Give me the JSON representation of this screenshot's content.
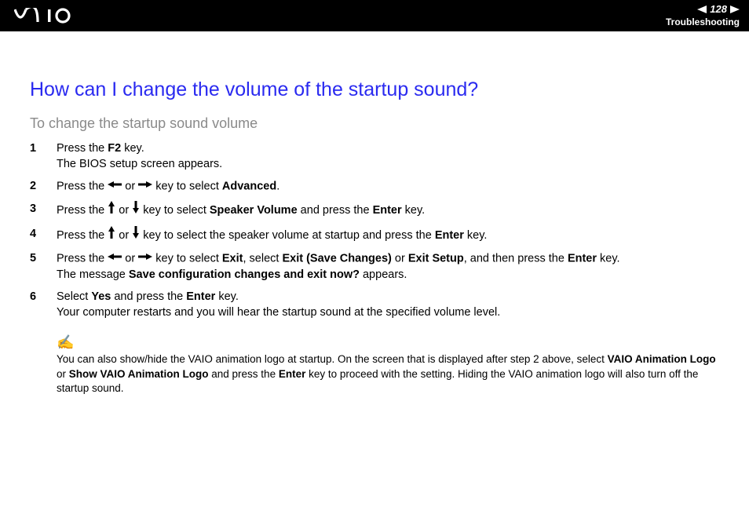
{
  "header": {
    "page_number": "128",
    "section": "Troubleshooting"
  },
  "title": "How can I change the volume of the startup sound?",
  "subtitle": "To change the startup sound volume",
  "steps": [
    {
      "pre1": "Press the ",
      "b1": "F2",
      "post1": " key.",
      "line2": "The BIOS setup screen appears."
    },
    {
      "pre1": "Press the ",
      "mid1": " or ",
      "post1": " key to select ",
      "b1": "Advanced",
      "end1": "."
    },
    {
      "pre1": "Press the ",
      "mid1": " or ",
      "post1": " key to select ",
      "b1": "Speaker Volume",
      "mid2": " and press the ",
      "b2": "Enter",
      "end1": " key."
    },
    {
      "pre1": "Press the ",
      "mid1": " or ",
      "post1": " key to select the speaker volume at startup and press the ",
      "b1": "Enter",
      "end1": " key."
    },
    {
      "pre1": "Press the ",
      "mid1": " or ",
      "post1": " key to select ",
      "b1": "Exit",
      "mid2": ", select ",
      "b2": "Exit (Save Changes)",
      "mid3": " or ",
      "b3": "Exit Setup",
      "mid4": ", and then press the ",
      "b4": "Enter",
      "end1": " key.",
      "line2_pre": "The message ",
      "line2_b": "Save configuration changes and exit now?",
      "line2_post": " appears."
    },
    {
      "pre1": "Select ",
      "b1": "Yes",
      "mid1": " and press the ",
      "b2": "Enter",
      "end1": " key.",
      "line2": "Your computer restarts and you will hear the startup sound at the specified volume level."
    }
  ],
  "note": {
    "icon": "✍",
    "t1": "You can also show/hide the VAIO animation logo at startup. On the screen that is displayed after step 2 above, select ",
    "b1": "VAIO Animation Logo",
    "t2": " or ",
    "b2": "Show VAIO Animation Logo",
    "t3": " and press the ",
    "b3": "Enter",
    "t4": " key to proceed with the setting. Hiding the VAIO animation logo will also turn off the startup sound."
  }
}
